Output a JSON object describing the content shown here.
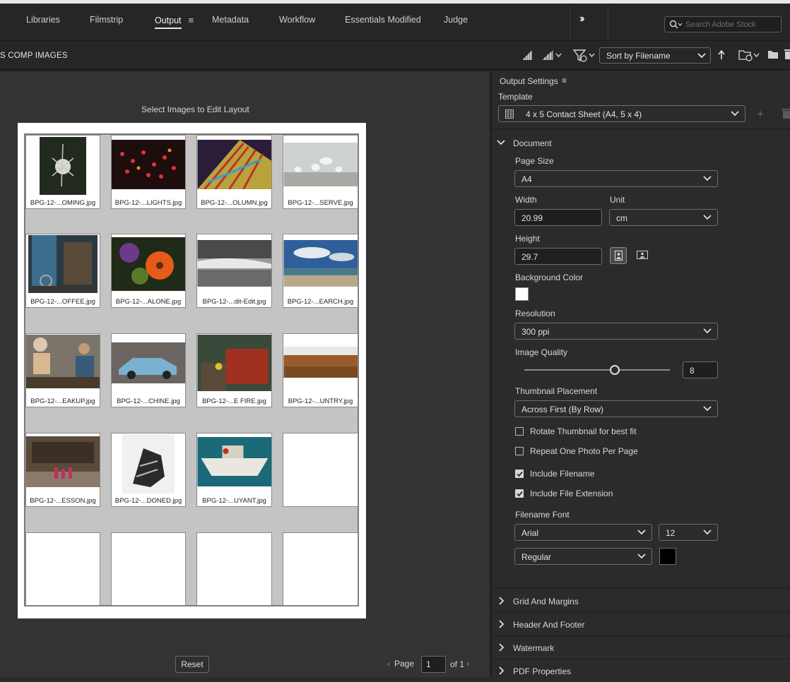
{
  "workspaces": [
    {
      "label": "Libraries",
      "active": false
    },
    {
      "label": "Filmstrip",
      "active": false
    },
    {
      "label": "Output",
      "active": true
    },
    {
      "label": "Metadata",
      "active": false
    },
    {
      "label": "Workflow",
      "active": false
    },
    {
      "label": "Essentials Modified",
      "active": false
    },
    {
      "label": "Judge",
      "active": false
    }
  ],
  "search": {
    "placeholder": "Search Adobe Stock"
  },
  "breadcrumb": "S COMP IMAGES",
  "sort": {
    "selected": "Sort by Filename"
  },
  "preview": {
    "select_label": "Select Images to Edit Layout",
    "filenames": [
      "BPG-12-...OMING.jpg",
      "BPG-12-...LIGHTS.jpg",
      "BPG-12-...OLUMN.jpg",
      "BPG-12-...SERVE.jpg",
      "BPG-12-...OFFEE.jpg",
      "BPG-12-...ALONE.jpg",
      "BPG-12-...dit-Edit.jpg",
      "BPG-12-...EARCH.jpg",
      "BPG-12-...EAKUP.jpg",
      "BPG-12-...CHINE.jpg",
      "BPG-12-...E FIRE.jpg",
      "BPG-12-...UNTRY.jpg",
      "BPG-12-...ESSON.jpg",
      "BPG-12-...DONED.jpg",
      "BPG-12-...UYANT.jpg"
    ],
    "reset_label": "Reset",
    "page_label": "Page",
    "page_value": "1",
    "of_label": "of 1"
  },
  "output_settings": {
    "title": "Output Settings",
    "template_label": "Template",
    "template_value": "4 x 5 Contact Sheet (A4, 5 x 4)",
    "document": {
      "title": "Document",
      "page_size_label": "Page Size",
      "page_size_value": "A4",
      "width_label": "Width",
      "width_value": "20.99",
      "unit_label": "Unit",
      "unit_value": "cm",
      "height_label": "Height",
      "height_value": "29.7",
      "bg_color_label": "Background Color",
      "bg_color": "#ffffff",
      "resolution_label": "Resolution",
      "resolution_value": "300 ppi",
      "image_quality_label": "Image Quality",
      "image_quality_value": "8",
      "image_quality_fraction": 0.62,
      "thumb_placement_label": "Thumbnail Placement",
      "thumb_placement_value": "Across First (By Row)",
      "checkboxes": [
        {
          "label": "Rotate Thumbnail for best fit",
          "checked": false
        },
        {
          "label": "Repeat One Photo Per Page",
          "checked": false
        },
        {
          "label": "Include Filename",
          "checked": true
        },
        {
          "label": "Include File Extension",
          "checked": true
        }
      ],
      "filename_font_label": "Filename Font",
      "font_value": "Arial",
      "font_size_value": "12",
      "font_style_value": "Regular",
      "font_color": "#000000"
    },
    "collapsed_sections": [
      "Grid And Margins",
      "Header And Footer",
      "Watermark",
      "PDF Properties"
    ]
  }
}
